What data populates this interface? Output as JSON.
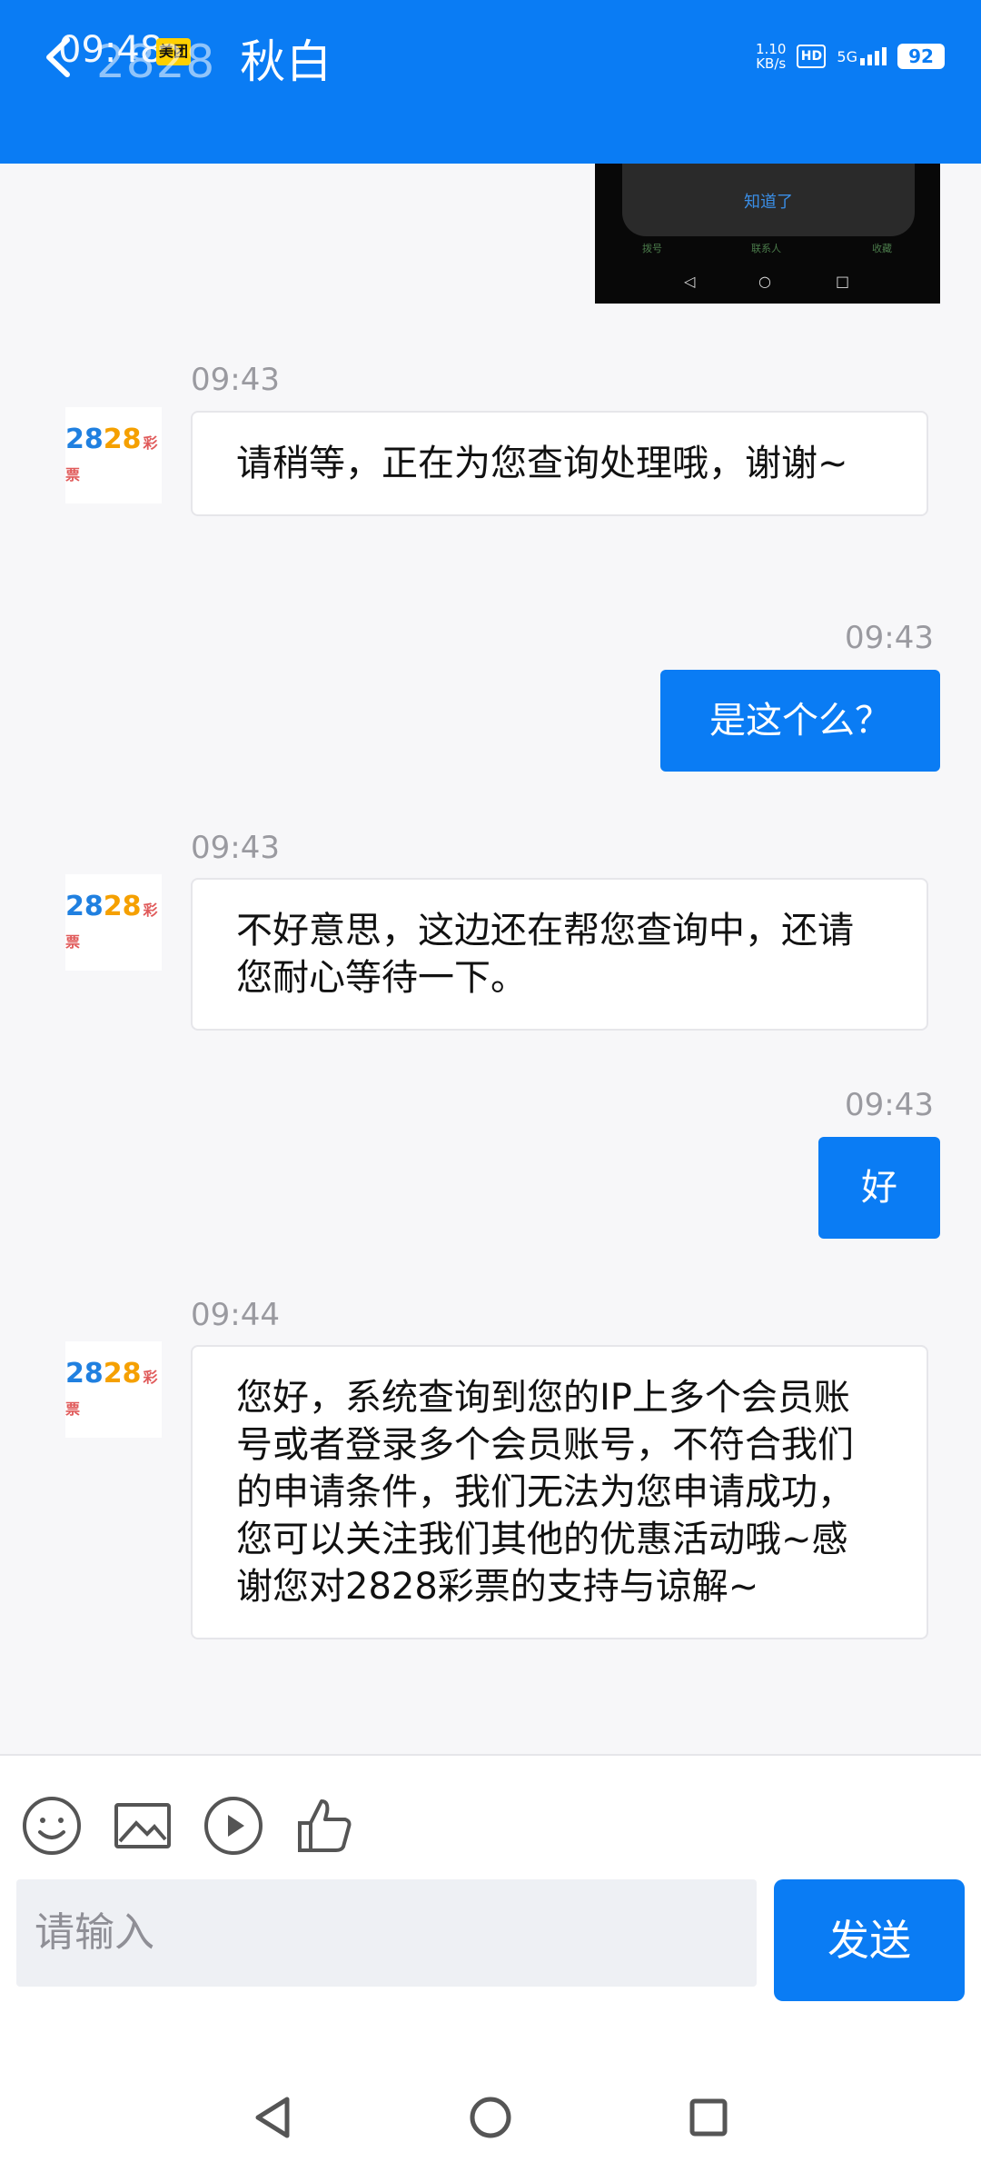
{
  "header": {
    "status_time": "09:48",
    "title": "秋白",
    "title_prefix": "2828",
    "meituan_label": "美团",
    "net_speed_value": "1.10",
    "net_speed_unit": "KB/s",
    "hd_label": "HD",
    "signal_label": "5G",
    "battery": "92"
  },
  "snippet": {
    "dialog_button": "知道了",
    "tabs": [
      "拨号",
      "联系人",
      "收藏"
    ]
  },
  "messages": [
    {
      "side": "left",
      "time": "09:43",
      "text": "请稍等，正在为您查询处理哦，谢谢~"
    },
    {
      "side": "right",
      "time": "09:43",
      "text": "是这个么？"
    },
    {
      "side": "left",
      "time": "09:43",
      "text": "不好意思，这边还在帮您查询中，还请您耐心等待一下。"
    },
    {
      "side": "right",
      "time": "09:43",
      "text": "好"
    },
    {
      "side": "left",
      "time": "09:44",
      "text": "您好，系统查询到您的IP上多个会员账号或者登录多个会员账号，不符合我们的申请条件，我们无法为您申请成功，您可以关注我们其他的优惠活动哦~感谢您对2828彩票的支持与谅解~"
    }
  ],
  "avatar": {
    "logo_text": "2828",
    "logo_label": "彩票"
  },
  "composer": {
    "placeholder": "请输入",
    "send_label": "发送"
  },
  "colors": {
    "accent": "#0a7cf4",
    "background": "#f7f7f9"
  }
}
